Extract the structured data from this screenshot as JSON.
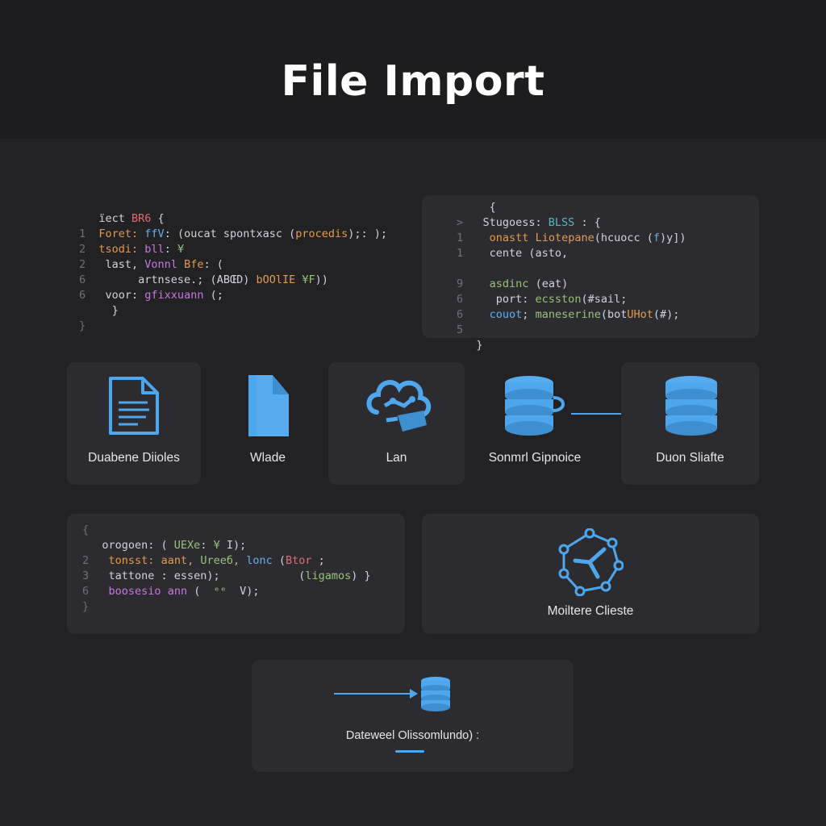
{
  "header": {
    "title": "File Import"
  },
  "code_left_top": {
    "lines": [
      [
        "",
        [
          [
            "ïect ",
            ""
          ],
          [
            "BR6",
            "k6"
          ],
          [
            " {",
            ""
          ]
        ]
      ],
      [
        "1",
        [
          [
            "Foret: ",
            "k1"
          ],
          [
            "ffV",
            "k3"
          ],
          [
            ": (oucat spontxasc (",
            ""
          ],
          [
            "procedis",
            "k1"
          ],
          [
            ");: );",
            ""
          ]
        ]
      ],
      [
        "2",
        [
          [
            "tsodi: ",
            "k1"
          ],
          [
            "bll",
            "k2"
          ],
          [
            ": ",
            ""
          ],
          [
            "¥",
            "k4"
          ]
        ]
      ],
      [
        "2",
        [
          [
            " last, ",
            ""
          ],
          [
            "Vonnl ",
            "k2"
          ],
          [
            "Bfe",
            "k1"
          ],
          [
            ": (",
            ""
          ]
        ]
      ],
      [
        "6",
        [
          [
            "      artnsese.; (ABŒD) ",
            ""
          ],
          [
            "bOOlIE",
            "k1"
          ],
          [
            " ",
            ""
          ],
          [
            "¥F",
            "k4"
          ],
          [
            "))",
            ""
          ]
        ]
      ],
      [
        "6",
        [
          [
            " voor: ",
            ""
          ],
          [
            "gfixxuann",
            "k2"
          ],
          [
            " (;",
            ""
          ]
        ]
      ],
      [
        "",
        [
          [
            "  }",
            ""
          ]
        ]
      ],
      [
        "}",
        []
      ]
    ]
  },
  "code_right_top": {
    "lines": [
      [
        "",
        [
          [
            "  {",
            ""
          ]
        ]
      ],
      [
        ">",
        [
          [
            " Stugoess: ",
            ""
          ],
          [
            "BLSS",
            "k7"
          ],
          [
            " : {",
            ""
          ]
        ]
      ],
      [
        "1",
        [
          [
            "  ",
            ""
          ],
          [
            "onastt ",
            "k1"
          ],
          [
            "Liotepane",
            "k1"
          ],
          [
            "(hcuocc (",
            ""
          ],
          [
            "f",
            "k3"
          ],
          [
            ")y])",
            ""
          ]
        ]
      ],
      [
        "1",
        [
          [
            "  cente (asto,",
            ""
          ]
        ]
      ],
      [
        "",
        []
      ],
      [
        "9",
        [
          [
            "  ",
            ""
          ],
          [
            "asdinc",
            "k4"
          ],
          [
            " (eat)",
            ""
          ]
        ]
      ],
      [
        "6",
        [
          [
            "   port: ",
            ""
          ],
          [
            "ecsston",
            "k4"
          ],
          [
            "(#sail;",
            ""
          ]
        ]
      ],
      [
        "6",
        [
          [
            "  ",
            ""
          ],
          [
            "couot",
            "k3"
          ],
          [
            "; ",
            ""
          ],
          [
            "maneserine",
            "k4"
          ],
          [
            "(bot",
            ""
          ],
          [
            "UHot",
            "k1"
          ],
          [
            "(#);",
            ""
          ]
        ]
      ],
      [
        "5",
        []
      ],
      [
        "",
        [
          [
            "}",
            ""
          ]
        ]
      ]
    ]
  },
  "code_left_bottom": {
    "lines": [
      [
        "{",
        []
      ],
      [
        "",
        [
          [
            "orogoen: ( ",
            ""
          ],
          [
            "UEXe",
            "k4"
          ],
          [
            ": ",
            ""
          ],
          [
            "¥",
            "k4"
          ],
          [
            " I);",
            ""
          ]
        ]
      ],
      [
        "2",
        [
          [
            " ",
            ""
          ],
          [
            "tonsst: ",
            "k1"
          ],
          [
            "aant, ",
            "k1"
          ],
          [
            "Ureeб, ",
            "k4"
          ],
          [
            "lonc ",
            "k3"
          ],
          [
            "(",
            ""
          ],
          [
            "Btor",
            "k6"
          ],
          [
            " ;",
            ""
          ]
        ]
      ],
      [
        "3",
        [
          [
            " tattone : essen);            (",
            ""
          ],
          [
            "ligamos",
            "k4"
          ],
          [
            ") }",
            ""
          ]
        ]
      ],
      [
        "6",
        [
          [
            " ",
            ""
          ],
          [
            "boosesio ",
            "k2"
          ],
          [
            "ann",
            "k2"
          ],
          [
            " (  ",
            ""
          ],
          [
            "ᵉᵉ",
            "k4"
          ],
          [
            "  V);",
            ""
          ]
        ]
      ],
      [
        "}",
        []
      ]
    ]
  },
  "tiles": [
    {
      "label": "Duabene Diioles",
      "icon": "document-icon"
    },
    {
      "label": "Wlade",
      "icon": "folder-icon"
    },
    {
      "label": "Lan",
      "icon": "cloud-network-icon"
    },
    {
      "label": "Sonmrl Gipnoice",
      "icon": "database-icon"
    },
    {
      "label": "Duon Sliafte",
      "icon": "database-icon"
    }
  ],
  "cluster": {
    "label": "Moiltere Clieste",
    "icon": "network-hub-icon"
  },
  "import_box": {
    "label": "Dateweel Olissomlundo) :",
    "icon": "database-icon"
  },
  "colors": {
    "accent": "#4ea6ec",
    "background": "#222225",
    "panel": "#2c2c30"
  }
}
